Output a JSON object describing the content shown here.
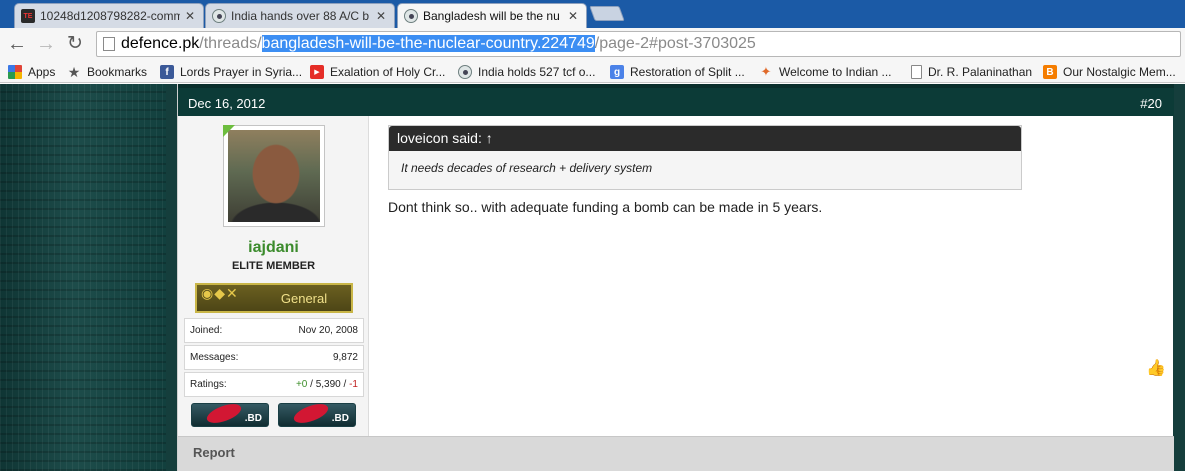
{
  "browser": {
    "tabs": [
      {
        "title": "10248d1208798282-comm",
        "icon": "te-favicon"
      },
      {
        "title": "India hands over 88 A/C b",
        "icon": "defence-pk-favicon"
      },
      {
        "title": "Bangladesh will be the nu",
        "icon": "defence-pk-favicon"
      }
    ],
    "url": {
      "host": "defence.pk",
      "path_prefix": "/threads/",
      "selected": "bangladesh-will-be-the-nuclear-country.224749",
      "path_suffix": "/page-2#post-3703025"
    },
    "bookmarks": [
      {
        "label": "Apps",
        "icon": "apps-icon"
      },
      {
        "label": "Bookmarks",
        "icon": "star-icon"
      },
      {
        "label": "Lords Prayer in Syria...",
        "icon": "facebook-icon"
      },
      {
        "label": "Exalation of Holy Cr...",
        "icon": "youtube-icon"
      },
      {
        "label": "India holds 527 tcf o...",
        "icon": "defence-pk-icon"
      },
      {
        "label": "Restoration of Split ...",
        "icon": "google-icon"
      },
      {
        "label": "Welcome to Indian ...",
        "icon": "indian-site-icon"
      },
      {
        "label": "Dr. R. Palaninathan",
        "icon": "page-icon"
      },
      {
        "label": "Our Nostalgic Mem...",
        "icon": "blogger-icon"
      }
    ]
  },
  "post": {
    "date": "Dec 16, 2012",
    "number": "#20",
    "user": {
      "name": "iajdani",
      "title": "ELITE MEMBER",
      "rank": "General",
      "joined_label": "Joined:",
      "joined": "Nov 20, 2008",
      "messages_label": "Messages:",
      "messages": "9,872",
      "ratings_label": "Ratings:",
      "ratings_pos": "+0",
      "ratings_sep1": "/",
      "ratings_mid": "5,390",
      "ratings_sep2": "/",
      "ratings_neg": "-1",
      "flag_tld": ".BD"
    },
    "quote": {
      "author": "loveicon said: ↑",
      "text": "It needs decades of research + delivery system"
    },
    "message": "Dont think so.. with adequate funding a bomb can be made in 5 years.",
    "report_label": "Report"
  }
}
